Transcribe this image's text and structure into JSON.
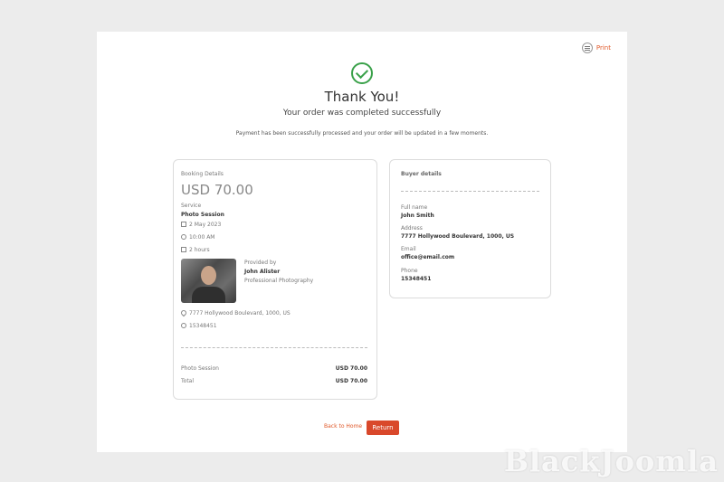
{
  "print_label": "Print",
  "header": {
    "title": "Thank You!",
    "subtitle": "Your order was completed successfully",
    "note": "Payment has been successfully processed and your order will be updated in a few moments."
  },
  "booking": {
    "heading": "Booking Details",
    "price": "USD 70.00",
    "service_label": "Service",
    "service_value": "Photo Session",
    "date": "2 May 2023",
    "time": "10:00 AM",
    "duration": "2 hours",
    "provided_by_label": "Provided by",
    "provider_name": "John Alister",
    "provider_title": "Professional Photography",
    "address": "7777 Hollywood Boulevard, 1000, US",
    "phone": "15348451",
    "summary": [
      {
        "label": "Photo Session",
        "value": "USD 70.00"
      },
      {
        "label": "Total",
        "value": "USD 70.00"
      }
    ]
  },
  "buyer": {
    "heading": "Buyer details",
    "full_name_label": "Full name",
    "full_name": "John Smith",
    "address_label": "Address",
    "address": "7777 Hollywood Boulevard, 1000, US",
    "email_label": "Email",
    "email": "office@email.com",
    "phone_label": "Phone",
    "phone": "15348451"
  },
  "footer": {
    "back_label": "Back to Home",
    "return_label": "Return"
  },
  "watermark": "BlackJoomla",
  "colors": {
    "accent": "#d9482b",
    "link": "#e0592a",
    "success": "#3aa14a"
  }
}
